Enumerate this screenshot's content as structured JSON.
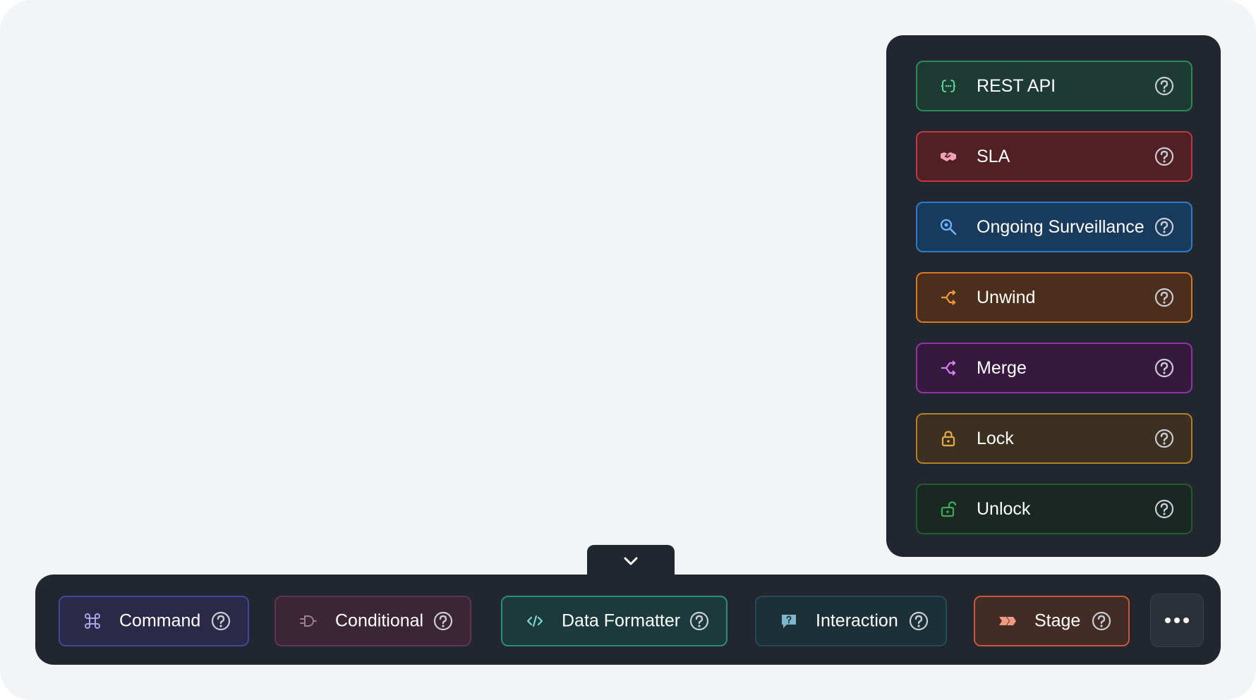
{
  "panel": {
    "items": [
      {
        "label": "REST API",
        "icon": "braces-icon",
        "bg": "#1d3b33",
        "border": "#2a8a5c",
        "icon_color": "#5fd39a"
      },
      {
        "label": "SLA",
        "icon": "handshake-icon",
        "bg": "#502024",
        "border": "#c0393f",
        "icon_color": "#f0a2b4"
      },
      {
        "label": "Ongoing Surveillance",
        "icon": "search-zoom-icon",
        "bg": "#183a5c",
        "border": "#2e7bc7",
        "icon_color": "#6fb6ff"
      },
      {
        "label": "Unwind",
        "icon": "split-arrows-icon",
        "bg": "#4b2f1c",
        "border": "#d07a28",
        "icon_color": "#f2993a"
      },
      {
        "label": "Merge",
        "icon": "merge-arrows-icon",
        "bg": "#37193f",
        "border": "#8f35a8",
        "icon_color": "#d880f0"
      },
      {
        "label": "Lock",
        "icon": "lock-icon",
        "bg": "#3c3020",
        "border": "#b67d2a",
        "icon_color": "#e6a84a"
      },
      {
        "label": "Unlock",
        "icon": "unlock-icon",
        "bg": "#1a2722",
        "border": "#1f5c2e",
        "icon_color": "#3fa85a"
      }
    ]
  },
  "toolbar": {
    "items": [
      {
        "label": "Command",
        "icon": "command-icon",
        "bg": "#2a2a48",
        "border": "#4a43a0",
        "icon_color": "#a9a4e6"
      },
      {
        "label": "Conditional",
        "icon": "plug-icon",
        "bg": "#3c2634",
        "border": "#5a3650",
        "icon_color": "#9d7f90"
      },
      {
        "label": "Data Formatter",
        "icon": "code-icon",
        "bg": "#1c3a3c",
        "border": "#2b8c80",
        "icon_color": "#7ad8cc"
      },
      {
        "label": "Interaction",
        "icon": "chat-question-icon",
        "bg": "#1c3038",
        "border": "#26495a",
        "icon_color": "#7fb6cc"
      },
      {
        "label": "Stage",
        "icon": "chevrons-right-icon",
        "bg": "#442c26",
        "border": "#c9583a",
        "icon_color": "#ef9a82"
      }
    ]
  },
  "colors": {
    "help_icon": "#c9ccd2"
  }
}
